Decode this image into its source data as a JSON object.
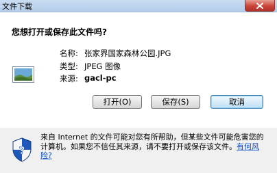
{
  "window": {
    "title": "文件下载",
    "close_icon": "close-icon"
  },
  "dialog": {
    "question": "您想打开或保存此文件吗?",
    "file_icon": "image-file-icon",
    "name_label": "名称:",
    "name_value": "张家界国家森林公园.JPG",
    "type_label": "类型:",
    "type_value": "JPEG 图像",
    "from_label": "来源:",
    "from_value": "gacl-pc"
  },
  "buttons": {
    "open": "打开(O)",
    "save": "保存(S)",
    "cancel": "取消"
  },
  "warning": {
    "icon": "security-shield-icon",
    "text": "来自 Internet 的文件可能对您有所帮助，但某些文件可能危害您的计算机。如果您不信任其来源，请不要打开或保存该文件。",
    "link": "有何风险?"
  }
}
